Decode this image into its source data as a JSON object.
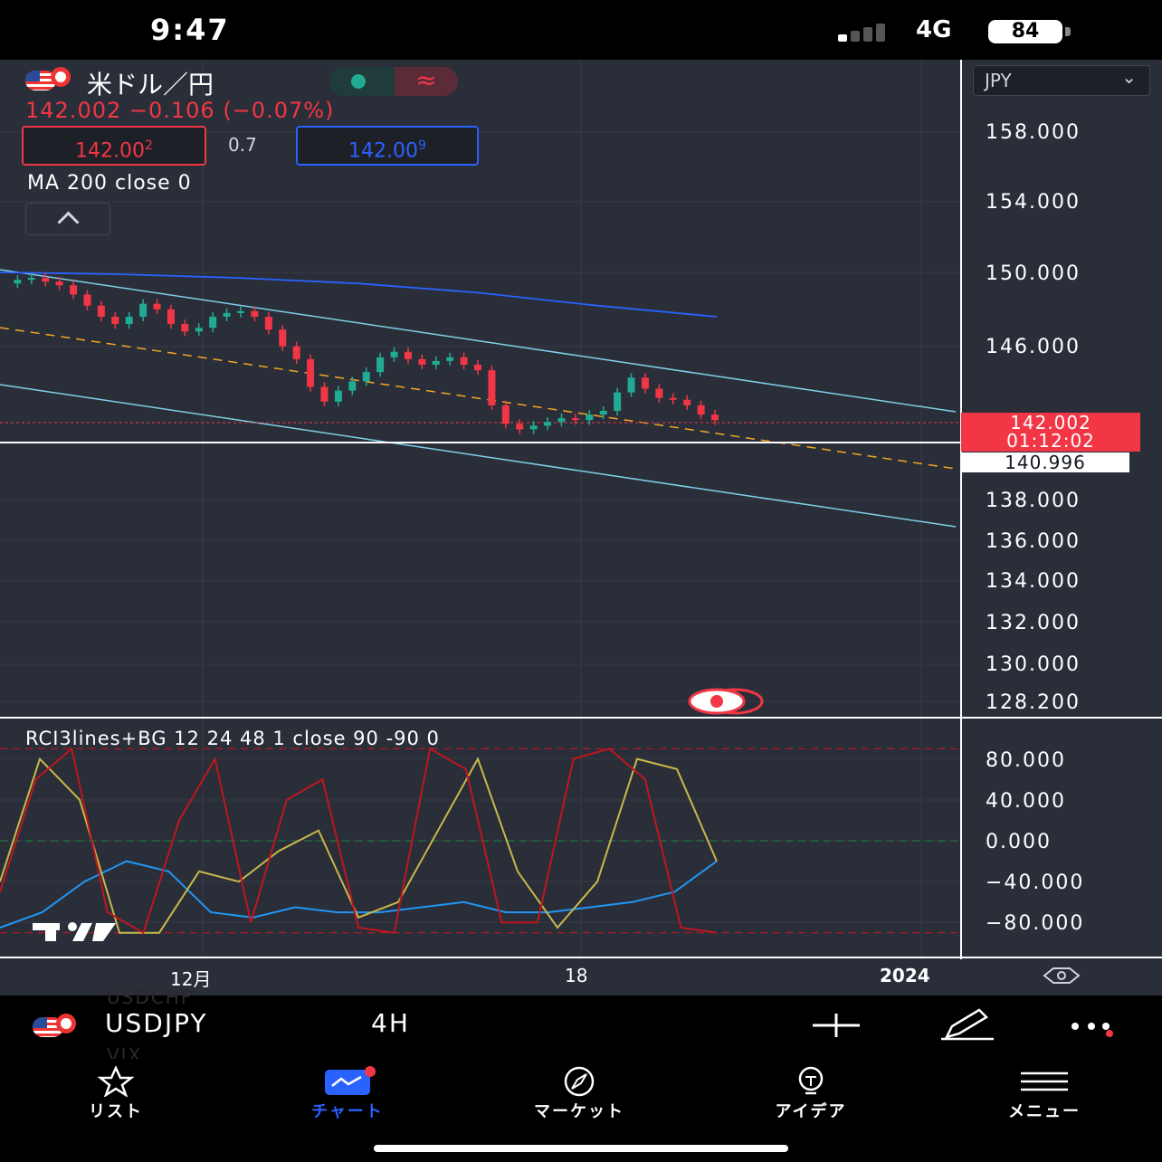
{
  "status": {
    "time": "9:47",
    "network": "4G",
    "battery": "84"
  },
  "header": {
    "symbol_title": "米ドル／円",
    "price_line": "142.002 −0.106 (−0.07%)",
    "sell_price_main": "142.00",
    "sell_price_sup": "2",
    "spread": "0.7",
    "buy_price_main": "142.00",
    "buy_price_sup": "9",
    "ma_label": "MA 200 close 0",
    "currency": "JPY",
    "colors": {
      "up": "#22ab94",
      "down": "#f23645",
      "accent": "#2962ff",
      "bg": "#2a2e39"
    }
  },
  "price_axis": [
    "158.000",
    "154.000",
    "150.000",
    "146.000",
    "142.002",
    "140.996",
    "138.000",
    "136.000",
    "134.000",
    "132.000",
    "130.000",
    "128.200"
  ],
  "badges": {
    "last_price": "142.002",
    "countdown": "01:12:02",
    "line_price": "140.996"
  },
  "rci": {
    "title": "RCI3lines+BG 12 24 48 1 close 90 -90 0",
    "axis": [
      "80.000",
      "40.000",
      "0.000",
      "−40.000",
      "−80.000"
    ]
  },
  "time_axis": [
    "12月",
    "18",
    "2024"
  ],
  "toolbar": {
    "ghost_top": "USDCHF",
    "ghost_bottom": "VIX",
    "symbol": "USDJPY",
    "timeframe": "4H"
  },
  "nav": [
    {
      "label": "リスト",
      "icon": "star-icon"
    },
    {
      "label": "チャート",
      "icon": "chart-icon"
    },
    {
      "label": "マーケット",
      "icon": "compass-icon"
    },
    {
      "label": "アイデア",
      "icon": "lightbulb-icon"
    },
    {
      "label": "メニュー",
      "icon": "menu-icon"
    }
  ],
  "chart_data": [
    {
      "type": "candlestick",
      "title": "米ドル／円",
      "ylim": [
        128.2,
        160
      ],
      "series": [
        {
          "name": "USDJPY 4H",
          "close_path": [
            149.4,
            149.6,
            149.7,
            149.5,
            149.3,
            148.8,
            148.2,
            147.6,
            147.2,
            147.6,
            148.3,
            148.0,
            147.2,
            146.8,
            147.0,
            147.6,
            147.8,
            147.9,
            147.6,
            146.9,
            146.0,
            145.3,
            143.8,
            143.0,
            143.6,
            144.1,
            144.6,
            145.4,
            145.7,
            145.3,
            145.0,
            145.2,
            145.4,
            145.0,
            144.7,
            142.8,
            141.8,
            141.5,
            141.7,
            141.9,
            142.1,
            142.0,
            142.3,
            142.5,
            143.5,
            144.3,
            143.7,
            143.2,
            143.1,
            142.8,
            142.3,
            142.0
          ]
        },
        {
          "name": "MA 200",
          "close_path": [
            150.0,
            149.9,
            149.7,
            149.4,
            148.9,
            148.2,
            147.6
          ]
        }
      ],
      "annotations": [
        "trend-channel",
        "horizontal-line 140.996"
      ]
    },
    {
      "type": "line",
      "title": "RCI3lines+BG 12 24 48 1 close 90 -90 0",
      "ylim": [
        -100,
        100
      ],
      "levels": [
        90,
        0,
        -90
      ],
      "series": [
        {
          "name": "12",
          "values": [
            -50,
            60,
            90,
            -70,
            -90,
            20,
            80,
            -80,
            40,
            60,
            -85,
            -90,
            90,
            70,
            -80,
            -80,
            80,
            90,
            60,
            -85,
            -90
          ]
        },
        {
          "name": "24",
          "values": [
            -40,
            80,
            40,
            -90,
            -90,
            -30,
            -40,
            -10,
            10,
            -75,
            -60,
            10,
            80,
            -30,
            -85,
            -40,
            80,
            70,
            -20
          ]
        },
        {
          "name": "48",
          "values": [
            -85,
            -70,
            -40,
            -20,
            -30,
            -70,
            -75,
            -65,
            -70,
            -70,
            -65,
            -60,
            -70,
            -70,
            -65,
            -60,
            -50,
            -20
          ]
        }
      ]
    }
  ]
}
